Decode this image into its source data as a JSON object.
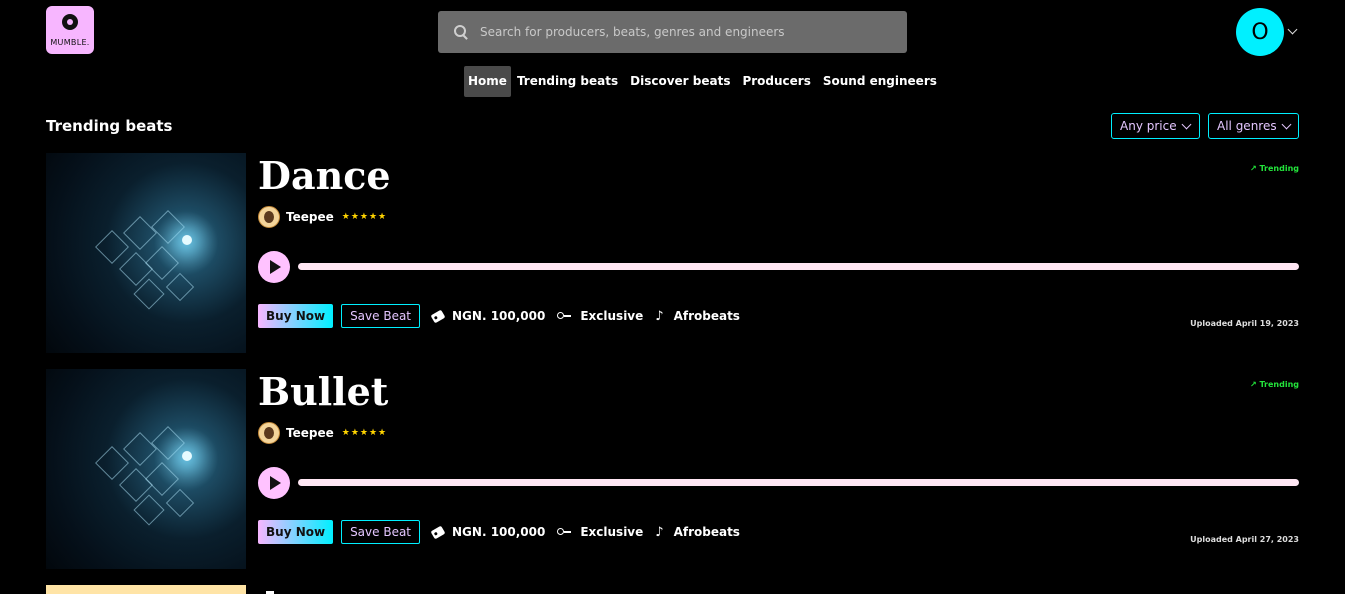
{
  "brand": {
    "logo_text": "MUMBLE."
  },
  "search": {
    "placeholder": "Search for producers, beats, genres and engineers"
  },
  "user": {
    "avatar_letter": "O"
  },
  "nav": [
    {
      "label": "Home",
      "active": true
    },
    {
      "label": "Trending beats"
    },
    {
      "label": "Discover beats"
    },
    {
      "label": "Producers"
    },
    {
      "label": "Sound engineers"
    }
  ],
  "section": {
    "title": "Trending beats",
    "filters": {
      "price": "Any price",
      "genre": "All genres"
    }
  },
  "beats": [
    {
      "title": "Dance",
      "producer": "Teepee",
      "stars": "★★★★★",
      "trending": "Trending",
      "buy_label": "Buy Now",
      "save_label": "Save Beat",
      "price": "NGN. 100,000",
      "license": "Exclusive",
      "genre": "Afrobeats",
      "uploaded": "Uploaded April 19, 2023",
      "progress": 0
    },
    {
      "title": "Bullet",
      "producer": "Teepee",
      "stars": "★★★★★",
      "trending": "Trending",
      "buy_label": "Buy Now",
      "save_label": "Save Beat",
      "price": "NGN. 100,000",
      "license": "Exclusive",
      "genre": "Afrobeats",
      "uploaded": "Uploaded April 27, 2023",
      "progress": 0
    }
  ],
  "colors": {
    "accent_cyan": "#00f0ff",
    "accent_pink": "#f7b6ff",
    "trending_green": "#23e33b",
    "star_yellow": "#ffd400"
  }
}
